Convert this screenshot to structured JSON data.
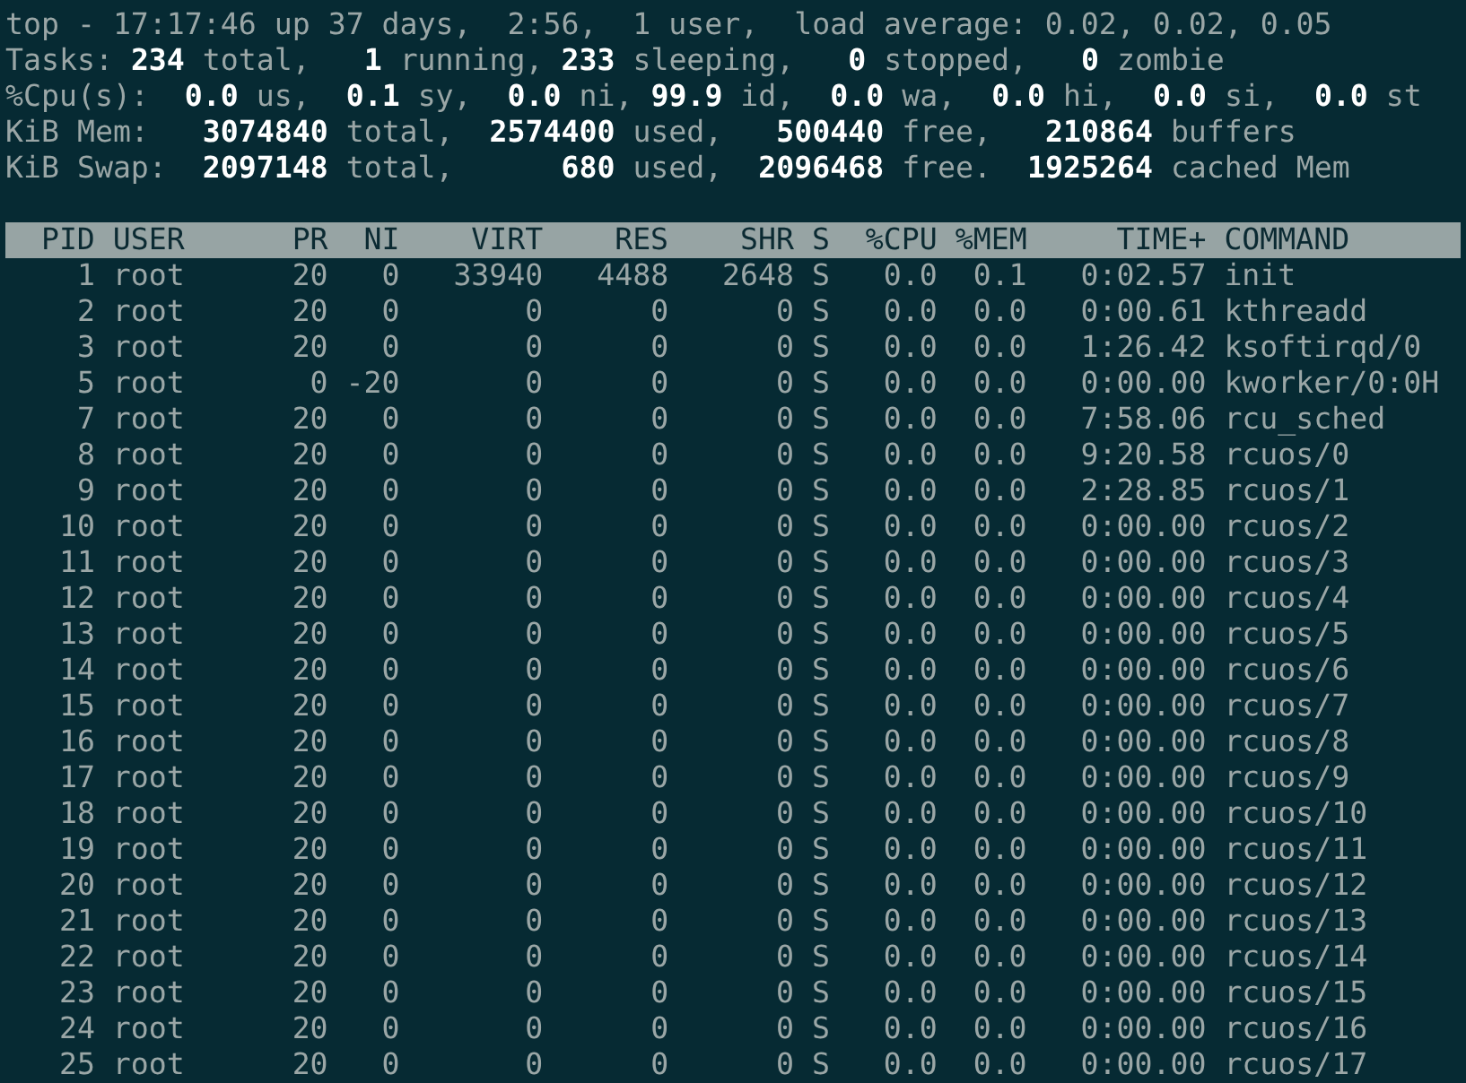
{
  "summary": [
    "top - 17:17:46 up 37 days,  2:56,  1 user,  load average: 0.02, 0.02, 0.05",
    "Tasks: **234** total,   **1** running, **233** sleeping,   **0** stopped,   **0** zombie",
    "%Cpu(s):  **0.0** us,  **0.1** sy,  **0.0** ni, **99.9** id,  **0.0** wa,  **0.0** hi,  **0.0** si,  **0.0** st",
    "KiB Mem:   **3074840** total,  **2574400** used,   **500440** free,   **210864** buffers",
    "KiB Swap:  **2097148** total,      **680** used,  **2096468** free.  **1925264** cached Mem"
  ],
  "table": {
    "columns": [
      "PID",
      "USER",
      "PR",
      "NI",
      "VIRT",
      "RES",
      "SHR",
      "S",
      "%CPU",
      "%MEM",
      "TIME+",
      "COMMAND"
    ],
    "rows": [
      [
        "1",
        "root",
        "20",
        "0",
        "33940",
        "4488",
        "2648",
        "S",
        "0.0",
        "0.1",
        "0:02.57",
        "init"
      ],
      [
        "2",
        "root",
        "20",
        "0",
        "0",
        "0",
        "0",
        "S",
        "0.0",
        "0.0",
        "0:00.61",
        "kthreadd"
      ],
      [
        "3",
        "root",
        "20",
        "0",
        "0",
        "0",
        "0",
        "S",
        "0.0",
        "0.0",
        "1:26.42",
        "ksoftirqd/0"
      ],
      [
        "5",
        "root",
        "0",
        "-20",
        "0",
        "0",
        "0",
        "S",
        "0.0",
        "0.0",
        "0:00.00",
        "kworker/0:0H"
      ],
      [
        "7",
        "root",
        "20",
        "0",
        "0",
        "0",
        "0",
        "S",
        "0.0",
        "0.0",
        "7:58.06",
        "rcu_sched"
      ],
      [
        "8",
        "root",
        "20",
        "0",
        "0",
        "0",
        "0",
        "S",
        "0.0",
        "0.0",
        "9:20.58",
        "rcuos/0"
      ],
      [
        "9",
        "root",
        "20",
        "0",
        "0",
        "0",
        "0",
        "S",
        "0.0",
        "0.0",
        "2:28.85",
        "rcuos/1"
      ],
      [
        "10",
        "root",
        "20",
        "0",
        "0",
        "0",
        "0",
        "S",
        "0.0",
        "0.0",
        "0:00.00",
        "rcuos/2"
      ],
      [
        "11",
        "root",
        "20",
        "0",
        "0",
        "0",
        "0",
        "S",
        "0.0",
        "0.0",
        "0:00.00",
        "rcuos/3"
      ],
      [
        "12",
        "root",
        "20",
        "0",
        "0",
        "0",
        "0",
        "S",
        "0.0",
        "0.0",
        "0:00.00",
        "rcuos/4"
      ],
      [
        "13",
        "root",
        "20",
        "0",
        "0",
        "0",
        "0",
        "S",
        "0.0",
        "0.0",
        "0:00.00",
        "rcuos/5"
      ],
      [
        "14",
        "root",
        "20",
        "0",
        "0",
        "0",
        "0",
        "S",
        "0.0",
        "0.0",
        "0:00.00",
        "rcuos/6"
      ],
      [
        "15",
        "root",
        "20",
        "0",
        "0",
        "0",
        "0",
        "S",
        "0.0",
        "0.0",
        "0:00.00",
        "rcuos/7"
      ],
      [
        "16",
        "root",
        "20",
        "0",
        "0",
        "0",
        "0",
        "S",
        "0.0",
        "0.0",
        "0:00.00",
        "rcuos/8"
      ],
      [
        "17",
        "root",
        "20",
        "0",
        "0",
        "0",
        "0",
        "S",
        "0.0",
        "0.0",
        "0:00.00",
        "rcuos/9"
      ],
      [
        "18",
        "root",
        "20",
        "0",
        "0",
        "0",
        "0",
        "S",
        "0.0",
        "0.0",
        "0:00.00",
        "rcuos/10"
      ],
      [
        "19",
        "root",
        "20",
        "0",
        "0",
        "0",
        "0",
        "S",
        "0.0",
        "0.0",
        "0:00.00",
        "rcuos/11"
      ],
      [
        "20",
        "root",
        "20",
        "0",
        "0",
        "0",
        "0",
        "S",
        "0.0",
        "0.0",
        "0:00.00",
        "rcuos/12"
      ],
      [
        "21",
        "root",
        "20",
        "0",
        "0",
        "0",
        "0",
        "S",
        "0.0",
        "0.0",
        "0:00.00",
        "rcuos/13"
      ],
      [
        "22",
        "root",
        "20",
        "0",
        "0",
        "0",
        "0",
        "S",
        "0.0",
        "0.0",
        "0:00.00",
        "rcuos/14"
      ],
      [
        "23",
        "root",
        "20",
        "0",
        "0",
        "0",
        "0",
        "S",
        "0.0",
        "0.0",
        "0:00.00",
        "rcuos/15"
      ],
      [
        "24",
        "root",
        "20",
        "0",
        "0",
        "0",
        "0",
        "S",
        "0.0",
        "0.0",
        "0:00.00",
        "rcuos/16"
      ],
      [
        "25",
        "root",
        "20",
        "0",
        "0",
        "0",
        "0",
        "S",
        "0.0",
        "0.0",
        "0:00.00",
        "rcuos/17"
      ]
    ]
  }
}
